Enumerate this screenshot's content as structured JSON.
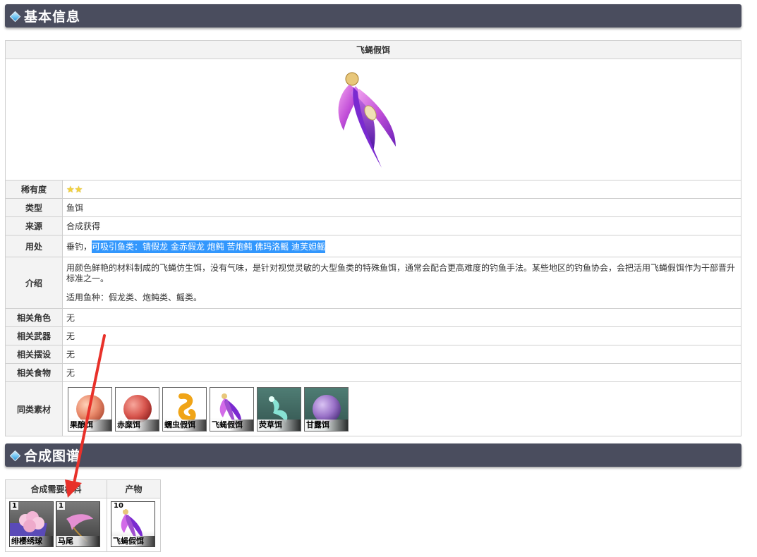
{
  "sections": {
    "basic_info": "基本信息",
    "crafting": "合成图谱"
  },
  "item": {
    "name": "飞蝇假饵",
    "image_icon": "fly-lure-icon"
  },
  "rows": [
    {
      "label": "稀有度",
      "stars": 2
    },
    {
      "label": "类型",
      "value": "鱼饵"
    },
    {
      "label": "来源",
      "value": "合成获得"
    },
    {
      "label": "用处",
      "value_plain": "垂钓，",
      "value_selected": "可吸引鱼类：锖假龙 金赤假龙 炮鲀 苦炮鲀 佛玛洛鳐 迪芙妲鳐"
    },
    {
      "label": "介绍",
      "intro_line1": "用颜色鲜艳的材料制成的飞蝇仿生饵，没有气味，是针对视觉灵敏的大型鱼类的特殊鱼饵，通常会配合更高难度的钓鱼手法。某些地区的钓鱼协会，会把活用飞蝇假饵作为干部晋升标准之一。",
      "intro_line2": "适用鱼种：假龙类、炮鲀类、鳐类。"
    },
    {
      "label": "相关角色",
      "value": "无"
    },
    {
      "label": "相关武器",
      "value": "无"
    },
    {
      "label": "相关摆设",
      "value": "无"
    },
    {
      "label": "相关食物",
      "value": "无"
    },
    {
      "label": "同类素材"
    }
  ],
  "similar_materials": [
    {
      "name": "果酿饵",
      "icon": "fruit-bait-icon",
      "color": "#e9896a"
    },
    {
      "name": "赤糜饵",
      "icon": "red-bait-icon",
      "color": "#d8564e"
    },
    {
      "name": "蠕虫假饵",
      "icon": "worm-lure-icon",
      "color": "#f0a417"
    },
    {
      "name": "飞蝇假饵",
      "icon": "fly-lure-icon",
      "color": "#a04fd0"
    },
    {
      "name": "荧草饵",
      "icon": "glowgrass-bait-icon",
      "color": "#8ff0e0"
    },
    {
      "name": "甘露饵",
      "icon": "sweet-bait-icon",
      "color": "#9a72c8"
    }
  ],
  "craft_table": {
    "header_materials": "合成需要材料",
    "header_product": "产物",
    "materials": [
      {
        "count": "1",
        "name": "绯樱绣球",
        "icon": "sakura-bloom-icon"
      },
      {
        "count": "1",
        "name": "马尾",
        "icon": "horsetail-icon"
      }
    ],
    "product": {
      "count": "10",
      "name": "飞蝇假饵",
      "icon": "fly-lure-icon"
    }
  },
  "annotation": {
    "arrow_color": "#e8312a"
  },
  "colors": {
    "header_bg": "#4a4d5e",
    "selection": "#3297fd",
    "table_border": "#cfcfcf",
    "label_bg": "#f3f3f3"
  }
}
